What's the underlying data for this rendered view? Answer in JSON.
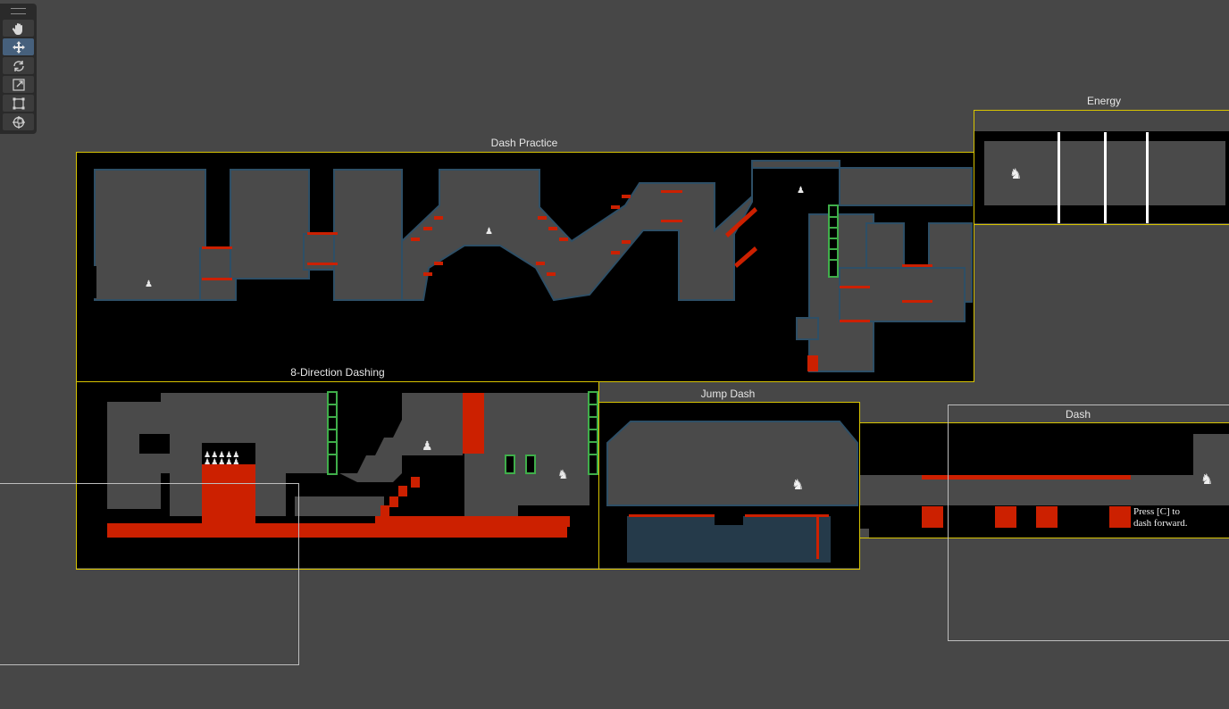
{
  "toolbar": {
    "tools": [
      {
        "name": "hand-tool",
        "icon": "hand-icon",
        "active": false
      },
      {
        "name": "move-tool",
        "icon": "move-arrows-icon",
        "active": true
      },
      {
        "name": "rotate-tool",
        "icon": "rotate-icon",
        "active": false
      },
      {
        "name": "scale-tool",
        "icon": "scale-icon",
        "active": false
      },
      {
        "name": "rect-tool",
        "icon": "rect-transform-icon",
        "active": false
      },
      {
        "name": "transform-tool",
        "icon": "transform-icon",
        "active": false
      }
    ]
  },
  "scenes": {
    "dash_practice": "Dash Practice",
    "energy": "Energy",
    "eight_direction": "8-Direction Dashing",
    "jump_dash": "Jump Dash",
    "dash": "Dash"
  },
  "hint": {
    "line1": "Press [C] to",
    "line2": "dash forward."
  },
  "colors": {
    "background": "#474747",
    "frame_selected": "#d8c400",
    "frame_plain": "#bdbdbd",
    "ground": "#000000",
    "room": "#4a4a4a",
    "hazard": "#cc2000",
    "ladder": "#3fae4a"
  }
}
